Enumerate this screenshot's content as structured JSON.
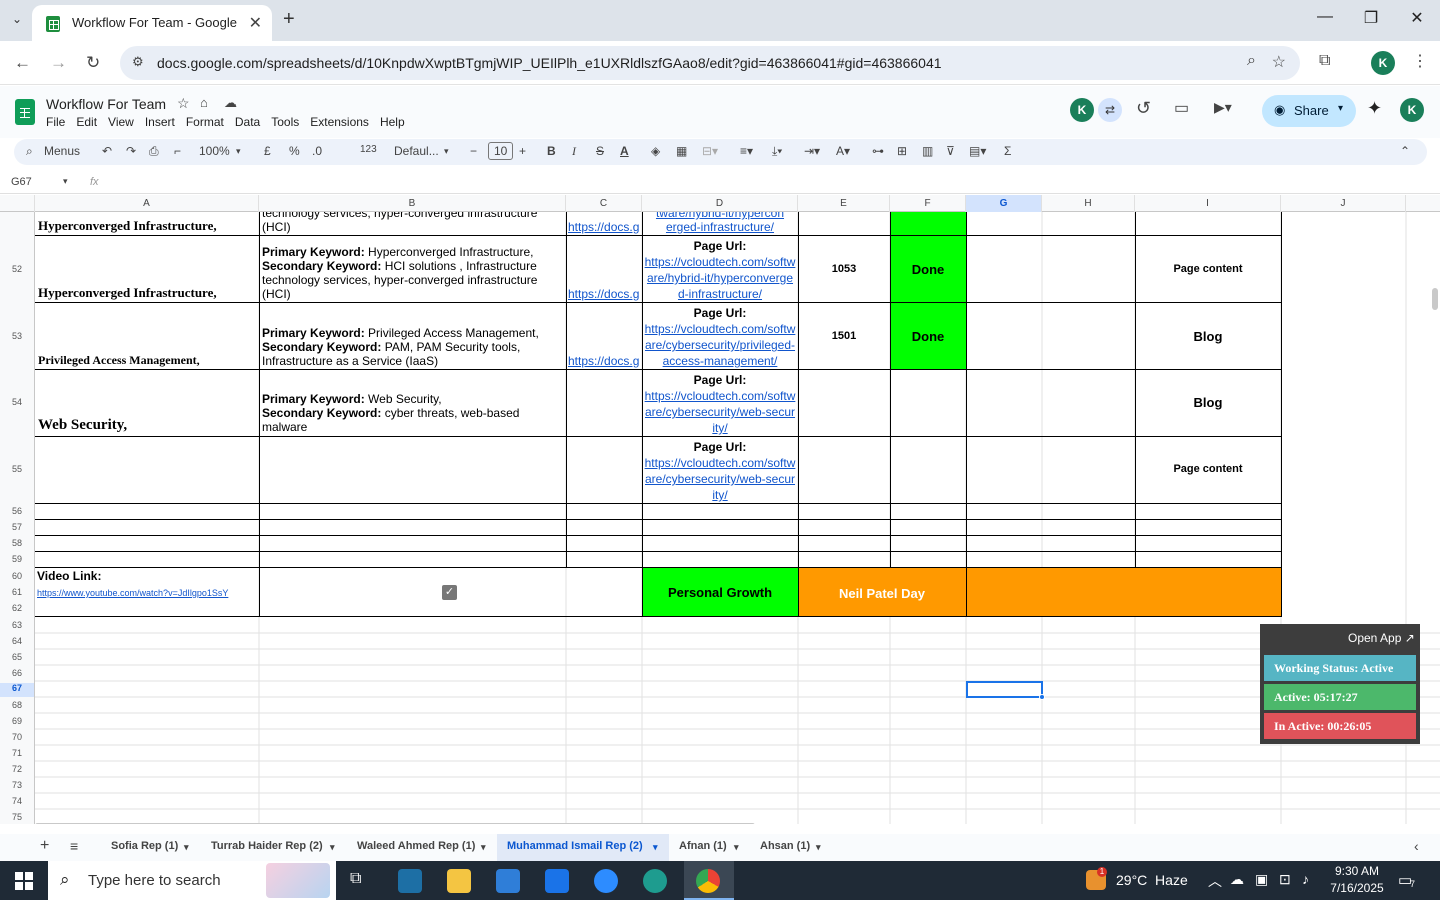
{
  "browser": {
    "tab_title": "Workflow For Team - Google Sh",
    "url": "docs.google.com/spreadsheets/d/10KnpdwXwptBTgmjWIP_UEIlPlh_e1UXRldlszfGAao8/edit?gid=463866041#gid=463866041",
    "profile_initial": "K"
  },
  "sheets": {
    "doc_title": "Workflow For Team",
    "menus": [
      "File",
      "Edit",
      "View",
      "Insert",
      "Format",
      "Data",
      "Tools",
      "Extensions",
      "Help"
    ],
    "share_label": "Share",
    "toolbar": {
      "search": "Menus",
      "zoom": "100%",
      "currency": "£",
      "percent": "%",
      "dec_less": ".0",
      ".00": ".00",
      "number_format": "123",
      "font": "Defaul...",
      "font_size": "10"
    },
    "name_box": "G67",
    "fx": "fx",
    "columns": [
      "A",
      "B",
      "C",
      "D",
      "E",
      "F",
      "G",
      "H",
      "I",
      "J"
    ],
    "rows": {
      "r51": {
        "num": "",
        "a": "Hyperconverged Infrastructure,",
        "b_top": "technology services, hyper-converged infrastructure",
        "b": "(HCI)",
        "c": "https://docs.g",
        "d_top": "tware/hybrid-it/hypercon",
        "d": "erged-infrastructure/"
      },
      "r52": {
        "num": "52",
        "a": "Hyperconverged Infrastructure,",
        "b_pk_label": "Primary Keyword:",
        "b_pk": " Hyperconverged Infrastructure,",
        "b_sk_label": "Secondary Keyword:",
        "b_sk": " HCI solutions , Infrastructure technology services, hyper-converged infrastructure (HCI)",
        "c": "https://docs.g",
        "d_label": "Page Url:",
        "d": "https://vcloudtech.com/software/hybrid-it/hyperconverged-infrastructure/",
        "e": "1053",
        "f": "Done",
        "i": "Page content"
      },
      "r53": {
        "num": "53",
        "a": "Privileged Access Management,",
        "b_pk_label": "Primary Keyword:",
        "b_pk": " Privileged Access Management,",
        "b_sk_label": "Secondary Keyword:",
        "b_sk": " PAM, PAM Security tools, Infrastructure as a Service (IaaS)",
        "c": "https://docs.g",
        "d_label": "Page Url:",
        "d": "https://vcloudtech.com/software/cybersecurity/privileged-access-management/",
        "e": "1501",
        "f": "Done",
        "i": "Blog"
      },
      "r54": {
        "num": "54",
        "a": "Web Security,",
        "b_pk_label": "Primary Keyword:",
        "b_pk": " Web Security,",
        "b_sk_label": "Secondary Keyword:",
        "b_sk": " cyber threats, web-based malware",
        "d_label": "Page Url:",
        "d": "https://vcloudtech.com/software/cybersecurity/web-security/",
        "i": "Blog"
      },
      "r55": {
        "num": "55",
        "d_label": "Page Url:",
        "d": "https://vcloudtech.com/software/cybersecurity/web-security/",
        "i": "Page content"
      },
      "r60": {
        "video_label": "Video Link:",
        "video_url": "https://www.youtube.com/watch?v=JdIlgpo1SsY",
        "personal_growth": "Personal Growth",
        "neil_patel": "Neil Patel Day"
      }
    },
    "row_numbers": [
      "52",
      "53",
      "54",
      "55",
      "56",
      "57",
      "58",
      "59",
      "60",
      "61",
      "62",
      "63",
      "64",
      "65",
      "66",
      "67",
      "68",
      "69",
      "70",
      "71",
      "72",
      "73",
      "74",
      "75"
    ],
    "sheet_tabs": [
      "Sofia Rep (1)",
      "Turrab Haider Rep (2)",
      "Waleed Ahmed Rep (1)",
      "Muhammad Ismail Rep (2)",
      "Afnan (1)",
      "Ahsan (1)"
    ],
    "active_tab": "Muhammad Ismail Rep (2)"
  },
  "widget": {
    "open_app": "Open App ↗",
    "status": "Working Status: Active",
    "active": "Active: 05:17:27",
    "inactive": "In Active: 00:26:05"
  },
  "taskbar": {
    "search_placeholder": "Type here to search",
    "weather": "29°C  Haze",
    "notif_count": "1",
    "time": "9:30 AM",
    "date": "7/16/2025",
    "action_center_count": "7"
  },
  "colors": {
    "done_green": "#00ff00",
    "orange": "#ff9900",
    "link": "#1155cc"
  }
}
